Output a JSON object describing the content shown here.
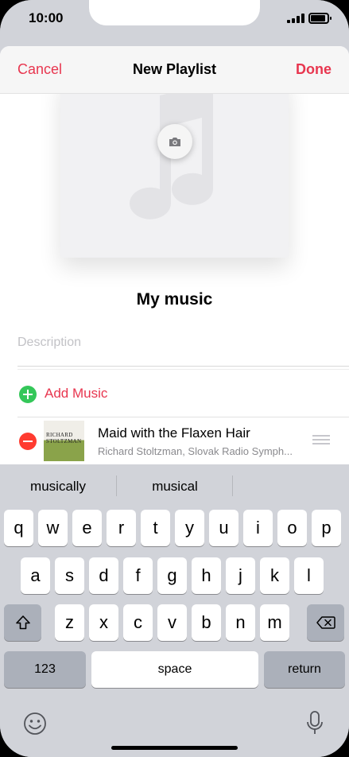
{
  "status_bar": {
    "time": "10:00"
  },
  "nav": {
    "cancel": "Cancel",
    "title": "New Playlist",
    "done": "Done"
  },
  "artwork": {
    "placeholder_icon": "music-note-icon",
    "action_icon": "camera-icon"
  },
  "playlist": {
    "name": "My music",
    "description_placeholder": "Description",
    "add_music": "Add Music",
    "songs": [
      {
        "title": "Maid with the Flaxen Hair",
        "artist": "Richard Stoltzman, Slovak Radio Symph...",
        "album_art_text": "RICHARD STOLTZMAN"
      }
    ]
  },
  "keyboard": {
    "suggestions": [
      "musically",
      "musical",
      ""
    ],
    "rows": [
      [
        "q",
        "w",
        "e",
        "r",
        "t",
        "y",
        "u",
        "i",
        "o",
        "p"
      ],
      [
        "a",
        "s",
        "d",
        "f",
        "g",
        "h",
        "j",
        "k",
        "l"
      ],
      [
        "z",
        "x",
        "c",
        "v",
        "b",
        "n",
        "m"
      ]
    ],
    "numbers_key": "123",
    "space_key": "space",
    "return_key": "return"
  },
  "colors": {
    "accent": "#e8364f",
    "add_green": "#34c759",
    "delete_red": "#ff3b30"
  }
}
